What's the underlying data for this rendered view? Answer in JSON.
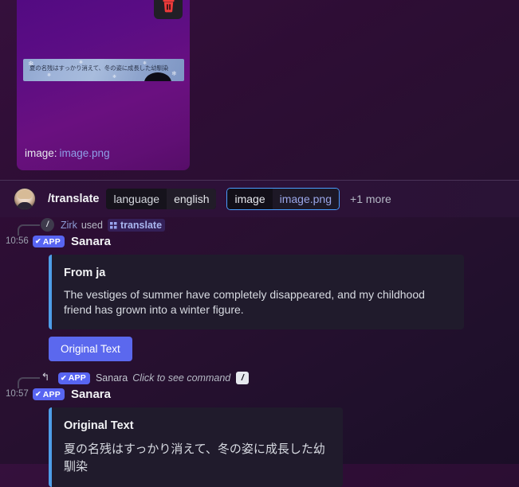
{
  "attachment": {
    "delete_icon": "trash-icon",
    "filename_label": "image:",
    "filename_value": "image.png",
    "preview_text": "夏の名残はすっかり消えて、冬の姿に成長した幼馴染"
  },
  "command_bar": {
    "avatar": "user-avatar",
    "command_name": "/translate",
    "options": [
      {
        "key": "language",
        "value": "english",
        "focused": false
      },
      {
        "key": "image",
        "value": "image.png",
        "focused": true
      }
    ],
    "more_label": "+1 more"
  },
  "messages": [
    {
      "system_line": {
        "icon": "slash-command-icon",
        "user": "Zirk",
        "action": "used",
        "command": "translate"
      },
      "timestamp": "10:56",
      "app_badge": "APP",
      "author": "Sanara",
      "embed": {
        "title": "From ja",
        "description": "The vestiges of summer have completely disappeared, and my childhood friend has grown into a winter figure."
      },
      "button": "Original Text"
    },
    {
      "reply_line": {
        "icon": "reply-arrow-icon",
        "app_badge": "APP",
        "author": "Sanara",
        "text": "Click to see command",
        "slash_glyph": "/"
      },
      "timestamp": "10:57",
      "app_badge": "APP",
      "author": "Sanara",
      "embed": {
        "title": "Original Text",
        "description": "夏の名残はすっかり消えて、冬の姿に成長した幼馴染"
      }
    }
  ],
  "colors": {
    "accent_blurple": "#5865f2",
    "embed_bar": "#4e9ee8",
    "focus_outline": "#4a9eff",
    "delete_red": "#ed3a3a",
    "attachment_purple": "#5b0d84"
  }
}
